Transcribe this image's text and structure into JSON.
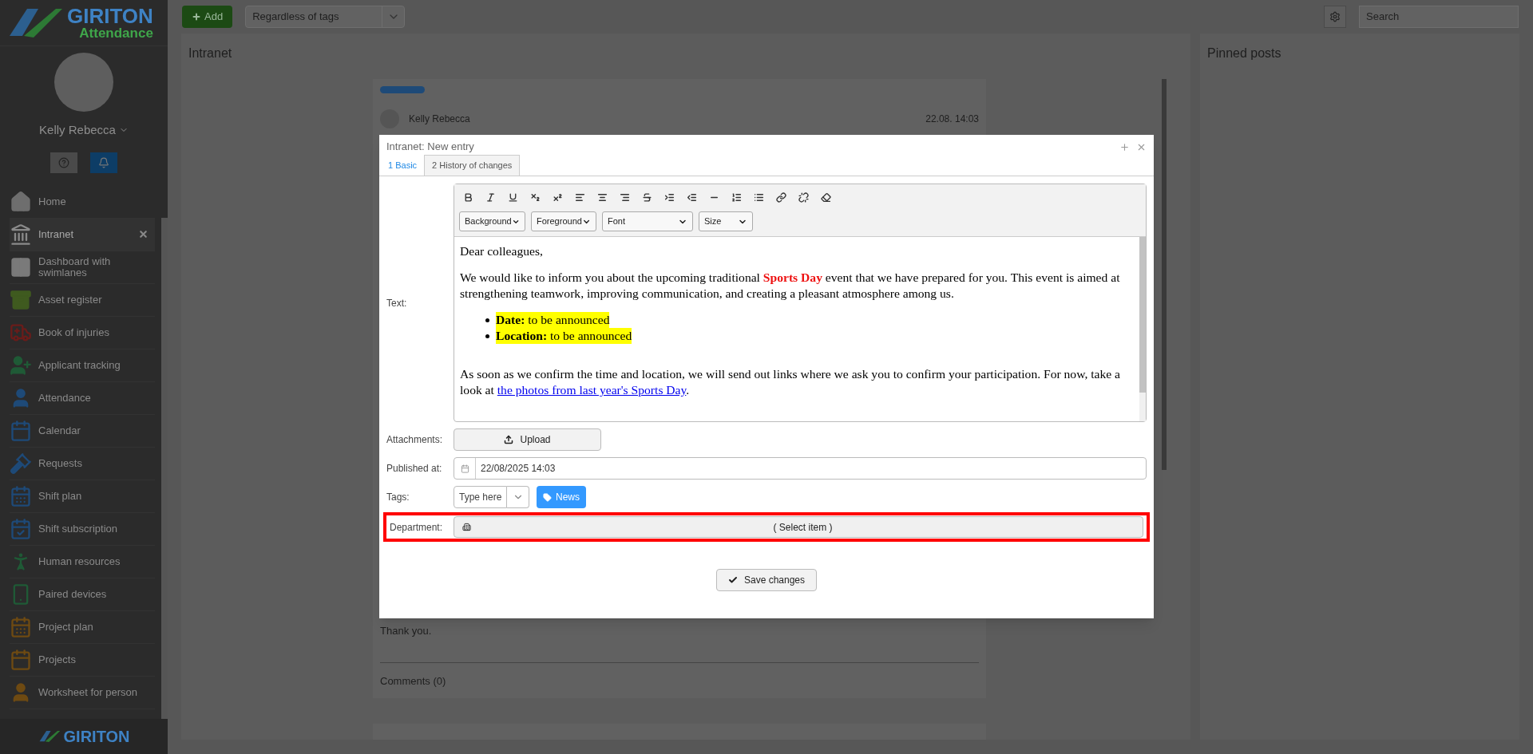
{
  "sidebar": {
    "logo": {
      "brand": "GIRITON",
      "product": "Attendance"
    },
    "user": "Kelly Rebecca",
    "items": [
      {
        "label": "Home",
        "selected": false,
        "closable": false
      },
      {
        "label": "Intranet",
        "selected": true,
        "closable": true
      },
      {
        "label": "Dashboard with swimlanes",
        "selected": false,
        "closable": false
      },
      {
        "label": "Asset register",
        "selected": false,
        "closable": false
      },
      {
        "label": "Book of injuries",
        "selected": false,
        "closable": false
      },
      {
        "label": "Applicant tracking",
        "selected": false,
        "closable": false
      },
      {
        "label": "Attendance",
        "selected": false,
        "closable": false
      },
      {
        "label": "Calendar",
        "selected": false,
        "closable": false
      },
      {
        "label": "Requests",
        "selected": false,
        "closable": false
      },
      {
        "label": "Shift plan",
        "selected": false,
        "closable": false
      },
      {
        "label": "Shift subscription",
        "selected": false,
        "closable": false
      },
      {
        "label": "Human resources",
        "selected": false,
        "closable": false
      },
      {
        "label": "Paired devices",
        "selected": false,
        "closable": false
      },
      {
        "label": "Project plan",
        "selected": false,
        "closable": false
      },
      {
        "label": "Projects",
        "selected": false,
        "closable": false
      },
      {
        "label": "Worksheet for person",
        "selected": false,
        "closable": false
      }
    ],
    "footer_logo": "GIRITON"
  },
  "toolbar": {
    "add": "Add",
    "tag_filter": "Regardless of tags",
    "search_placeholder": "Search"
  },
  "intranet_panel": {
    "title": "Intranet",
    "post": {
      "author": "Kelly Rebecca",
      "date": "22.08. 14:03",
      "closing": "Thank you.",
      "comments": "Comments (0)"
    }
  },
  "pinned_panel": {
    "title": "Pinned posts"
  },
  "dialog": {
    "title": "Intranet: New entry",
    "tabs": [
      {
        "label": "1 Basic",
        "selected": true
      },
      {
        "label": "2 History of changes",
        "selected": false
      }
    ],
    "text_label": "Text:",
    "selects": [
      "Background",
      "Foreground",
      "Font",
      "Size"
    ],
    "content": [
      {
        "kind": "paragraph",
        "parts": [
          {
            "kind": "text",
            "text": "Dear colleagues,"
          }
        ]
      },
      {
        "kind": "paragraph",
        "parts": [
          {
            "kind": "text",
            "text": "We would like to inform you about the upcoming traditional "
          },
          {
            "kind": "highlight",
            "text": "Sports Day"
          },
          {
            "kind": "text",
            "text": " event that we have prepared for you. This event is aimed at strengthening teamwork, improving communication, and creating a pleasant atmosphere among us."
          }
        ]
      },
      {
        "kind": "list",
        "items": [
          {
            "label": "Date:",
            "text": " to be announced"
          },
          {
            "label": "Location:",
            "text": " to be announced"
          }
        ]
      },
      {
        "kind": "paragraph",
        "parts": [
          {
            "kind": "text",
            "text": "As soon as we confirm the time and location, we will send out links where we ask you to confirm your participation. For now, take a look at "
          },
          {
            "kind": "link",
            "text": "the photos from last year's Sports Day"
          },
          {
            "kind": "text",
            "text": "."
          }
        ]
      }
    ],
    "attachments": {
      "label": "Attachments:",
      "button": "Upload"
    },
    "published": {
      "label": "Published at:",
      "value": "22/08/2025 14:03"
    },
    "tags": {
      "label": "Tags:",
      "placeholder": "Type here",
      "chips": [
        "News"
      ]
    },
    "department": {
      "label": "Department:",
      "button": "( Select item )",
      "highlighted": true
    },
    "save": "Save changes"
  }
}
